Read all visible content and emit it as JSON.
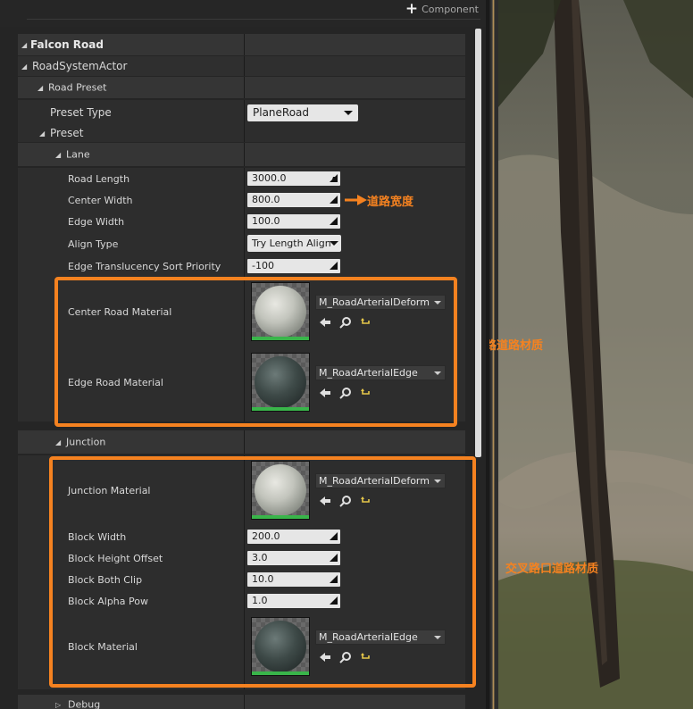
{
  "toolbar": {
    "add_component_label": "Component"
  },
  "tree": {
    "falcon_road": "Falcon Road",
    "road_system_actor": "RoadSystemActor",
    "road_preset": "Road Preset",
    "preset_type_label": "Preset Type",
    "preset_type_value": "PlaneRoad",
    "preset": "Preset",
    "lane": "Lane",
    "junction": "Junction",
    "debug": "Debug"
  },
  "lane_props": [
    {
      "label": "Road Length",
      "value": "3000.0"
    },
    {
      "label": "Center Width",
      "value": "800.0"
    },
    {
      "label": "Edge Width",
      "value": "100.0"
    },
    {
      "label": "Align Type",
      "value": "Try Length Align"
    },
    {
      "label": "Edge Translucency Sort Priority",
      "value": "-100"
    }
  ],
  "lane_materials": [
    {
      "label": "Center Road Material",
      "asset": "M_RoadArterialDeform",
      "swatch": "light"
    },
    {
      "label": "Edge Road Material",
      "asset": "M_RoadArterialEdge",
      "swatch": "dark"
    }
  ],
  "junction_material": {
    "label": "Junction Material",
    "asset": "M_RoadArterialDeform",
    "swatch": "light"
  },
  "junction_props": [
    {
      "label": "Block Width",
      "value": "200.0"
    },
    {
      "label": "Block Height Offset",
      "value": "3.0"
    },
    {
      "label": "Block Both Clip",
      "value": "10.0"
    },
    {
      "label": "Block Alpha Pow",
      "value": "1.0"
    }
  ],
  "block_material": {
    "label": "Block Material",
    "asset": "M_RoadArterialEdge",
    "swatch": "dark"
  },
  "annotations": {
    "road_width": "道路宽度",
    "main_road_material": "主路道路材质",
    "junction_road_material": "交叉路口道路材质"
  },
  "colors": {
    "highlight": "#f58220",
    "asset_ok": "#39b54a"
  },
  "icons": {
    "add": "plus-icon",
    "drag": "drag-handle-icon",
    "use": "use-selected-arrow-icon",
    "browse": "browse-magnifier-icon",
    "reset": "reset-to-default-icon"
  }
}
